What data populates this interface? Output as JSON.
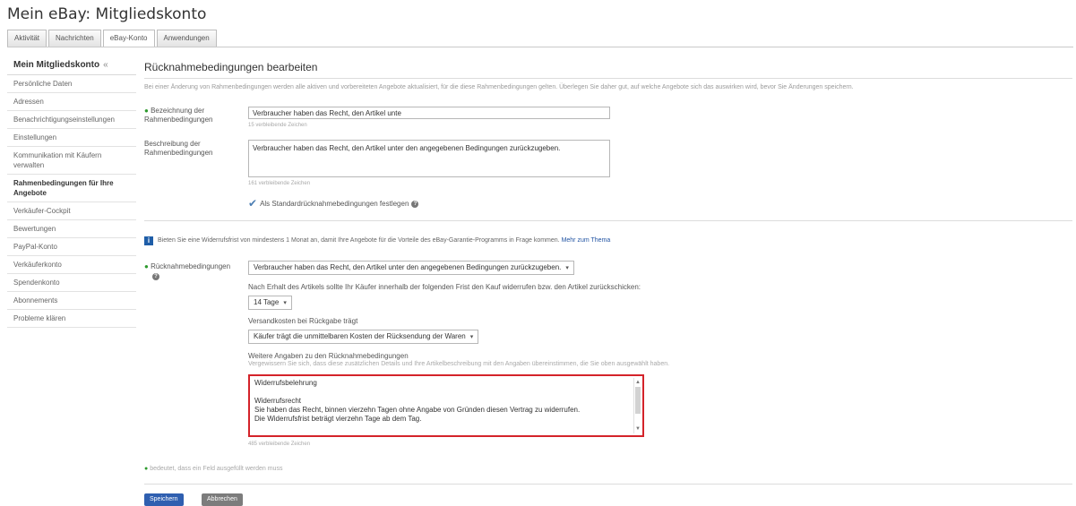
{
  "page_title": "Mein eBay: Mitgliedskonto",
  "tabs": [
    {
      "label": "Aktivität"
    },
    {
      "label": "Nachrichten"
    },
    {
      "label": "eBay-Konto"
    },
    {
      "label": "Anwendungen"
    }
  ],
  "active_tab": "eBay-Konto",
  "sidebar": {
    "header": "Mein Mitgliedskonto",
    "header_arrow": "«",
    "items": [
      {
        "label": "Persönliche Daten"
      },
      {
        "label": "Adressen"
      },
      {
        "label": "Benachrichtigungseinstellungen"
      },
      {
        "label": "Einstellungen"
      },
      {
        "label": "Kommunikation mit Käufern verwalten"
      },
      {
        "label": "Rahmenbedingungen für Ihre Angebote"
      },
      {
        "label": "Verkäufer-Cockpit"
      },
      {
        "label": "Bewertungen"
      },
      {
        "label": "PayPal-Konto"
      },
      {
        "label": "Verkäuferkonto"
      },
      {
        "label": "Spendenkonto"
      },
      {
        "label": "Abonnements"
      },
      {
        "label": "Probleme klären"
      }
    ]
  },
  "main": {
    "title": "Rücknahmebedingungen bearbeiten",
    "intro": "Bei einer Änderung von Rahmenbedingungen werden alle aktiven und vorbereiteten Angebote aktualisiert, für die diese Rahmenbedingungen gelten. Überlegen Sie daher gut, auf welche Angebote sich das auswirken wird, bevor Sie Änderungen speichern.",
    "required_mark": "●",
    "name_label": "Bezeichnung der Rahmenbedingungen",
    "name_value": "Verbraucher haben das Recht, den Artikel unte",
    "name_hint": "15 verbleibende Zeichen",
    "desc_label": "Beschreibung der Rahmenbedingungen",
    "desc_value": "Verbraucher haben das Recht, den Artikel unter den angegebenen Bedingungen zurückzugeben.",
    "desc_hint": "161 verbleibende Zeichen",
    "default_checkbox_label": "Als Standardrücknahmebedingungen festlegen",
    "help_glyph": "?",
    "info_glyph": "i",
    "notice_text": "Bieten Sie eine Widerrufsfrist von mindestens 1 Monat an, damit Ihre Angebote für die Vorteile des eBay-Garantie-Programms in Frage kommen.",
    "notice_link": "Mehr zum Thema",
    "returns_label": "Rücknahmebedingungen",
    "returns_select": "Verbraucher haben das Recht, den Artikel unter den angegebenen Bedingungen zurückzugeben.",
    "period_text": "Nach Erhalt des Artikels sollte Ihr Käufer innerhalb der folgenden Frist den Kauf widerrufen bzw. den Artikel zurückschicken:",
    "period_select": "14 Tage",
    "shipping_label": "Versandkosten bei Rückgabe trägt",
    "shipping_select": "Käufer trägt die unmittelbaren Kosten der Rücksendung der Waren",
    "details_label": "Weitere Angaben zu den Rücknahmebedingungen",
    "details_hint": "Vergewissern Sie sich, dass diese zusätzlichen Details und Ihre Artikelbeschreibung mit den Angaben übereinstimmen, die Sie oben ausgewählt haben.",
    "details_lines": [
      "Widerrufsbelehrung",
      "",
      "Widerrufsrecht",
      "Sie haben das Recht, binnen vierzehn Tagen ohne Angabe von Gründen diesen Vertrag zu widerrufen.",
      "Die Widerrufsfrist beträgt vierzehn Tage ab dem Tag."
    ],
    "details_remaining": "485 verbleibende Zeichen",
    "required_note": "bedeutet, dass ein Feld ausgefüllt werden muss",
    "save_button": "Speichern",
    "cancel_button": "Abbrechen"
  },
  "icons": {
    "dropdown": "▾",
    "checkmark": "✔",
    "scroll_up": "▲",
    "scroll_down": "▼"
  },
  "colors": {
    "highlight_border": "#d4232a",
    "primary_button": "#2f5fb0",
    "link": "#2254a3",
    "required": "#2e9a2e"
  }
}
